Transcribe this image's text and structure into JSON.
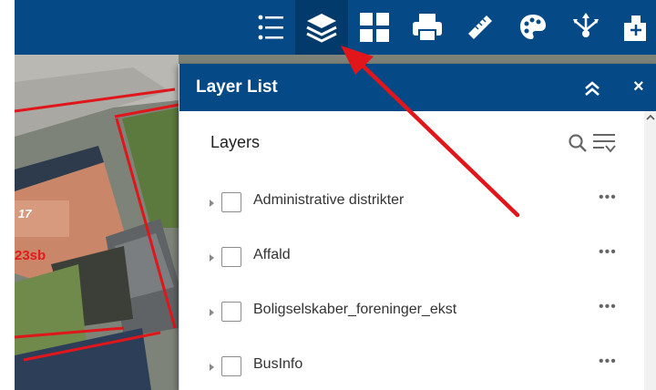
{
  "toolbar": {
    "tools": [
      {
        "name": "legend-icon",
        "active": false
      },
      {
        "name": "layers-icon",
        "active": true
      },
      {
        "name": "basemap-gallery-icon",
        "active": false
      },
      {
        "name": "print-icon",
        "active": false
      },
      {
        "name": "measurement-icon",
        "active": false
      },
      {
        "name": "style-palette-icon",
        "active": false
      },
      {
        "name": "directions-icon",
        "active": false
      },
      {
        "name": "add-data-icon",
        "active": false
      }
    ]
  },
  "map": {
    "labels": {
      "house_number": "17",
      "building_code": "23sb"
    },
    "colors": {
      "parcel_outline": "#e0161b",
      "label_red": "#e21b1b"
    }
  },
  "panel": {
    "title": "Layer List",
    "close_glyph": "×",
    "layers_heading": "Layers",
    "layers": [
      {
        "name": "Administrative distrikter",
        "checked": false
      },
      {
        "name": "Affald",
        "checked": false
      },
      {
        "name": "Boligselskaber_foreninger_ekst",
        "checked": false
      },
      {
        "name": "BusInfo",
        "checked": false
      }
    ],
    "more_glyph": "•••"
  },
  "colors": {
    "header": "#054a87",
    "active_tool": "#033a6c",
    "annotation_arrow": "#e0161b"
  }
}
